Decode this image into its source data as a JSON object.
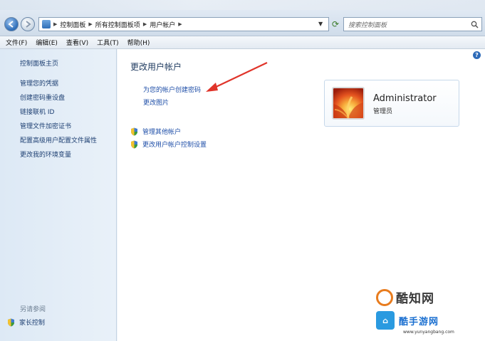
{
  "address_bar": {
    "crumbs": [
      "控制面板",
      "所有控制面板项",
      "用户帐户"
    ]
  },
  "search": {
    "placeholder": "搜索控制面板"
  },
  "menu": {
    "items": [
      "文件(F)",
      "编辑(E)",
      "查看(V)",
      "工具(T)",
      "帮助(H)"
    ]
  },
  "sidebar": {
    "home": "控制面板主页",
    "links": [
      "管理您的凭据",
      "创建密码重设盘",
      "链接联机 ID",
      "管理文件加密证书",
      "配置高级用户配置文件属性",
      "更改我的环境变量"
    ],
    "see_also_heading": "另请参阅",
    "parental_controls": "家长控制"
  },
  "main": {
    "title": "更改用户帐户",
    "links": [
      "为您的帐户创建密码",
      "更改图片"
    ],
    "shield_links": [
      "管理其他帐户",
      "更改用户帐户控制设置"
    ]
  },
  "account": {
    "name": "Administrator",
    "role": "管理员"
  },
  "watermark": {
    "brand": "酷知网",
    "brand2": "酷手游网",
    "url": "www.yunyangbang.com"
  },
  "colors": {
    "link": "#1f4fa8",
    "sidebar_link": "#1d3f72",
    "annotation_arrow": "#e0342a"
  }
}
